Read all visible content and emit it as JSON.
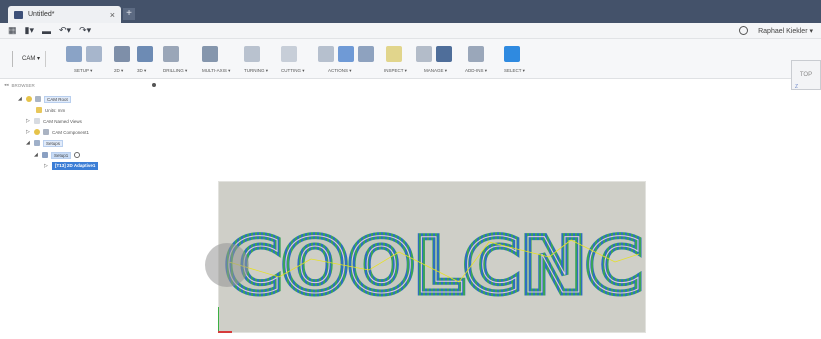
{
  "tab": {
    "title": "Untitled*",
    "close": "×",
    "new": "+"
  },
  "qat": {
    "grid": "▦",
    "file": "▮▾",
    "save": "▬",
    "undo": "↶▾",
    "redo": "↷▾",
    "user": "Raphael Kiekler ▾"
  },
  "ribbon": {
    "workspace": "CAM ▾",
    "groups": [
      {
        "label": "SETUP ▾"
      },
      {
        "label": "2D ▾"
      },
      {
        "label": "3D ▾"
      },
      {
        "label": "DRILLING ▾"
      },
      {
        "label": "MULTI-AXIS ▾"
      },
      {
        "label": "TURNING ▾"
      },
      {
        "label": "CUTTING ▾"
      },
      {
        "label": "ACTIONS ▾"
      },
      {
        "label": "INSPECT ▾"
      },
      {
        "label": "MANAGE ▾"
      },
      {
        "label": "ADD-INS ▾"
      },
      {
        "label": "SELECT ▾"
      }
    ]
  },
  "browser": {
    "header": "BROWSER",
    "root": "CAM Root",
    "units": "Units: mm",
    "named_views": "CAM Named Views",
    "component": "CAM Component1",
    "setups": "Setups",
    "setup1": "Setup1",
    "operation": "[T13] 2D Adaptive1"
  },
  "viewcube": {
    "label": "TOP"
  },
  "canvas": {
    "text": "COOLCNC"
  },
  "colors": {
    "tabbar": "#44526a",
    "accent": "#3c7ed6",
    "stock": "#cfcfc8"
  }
}
